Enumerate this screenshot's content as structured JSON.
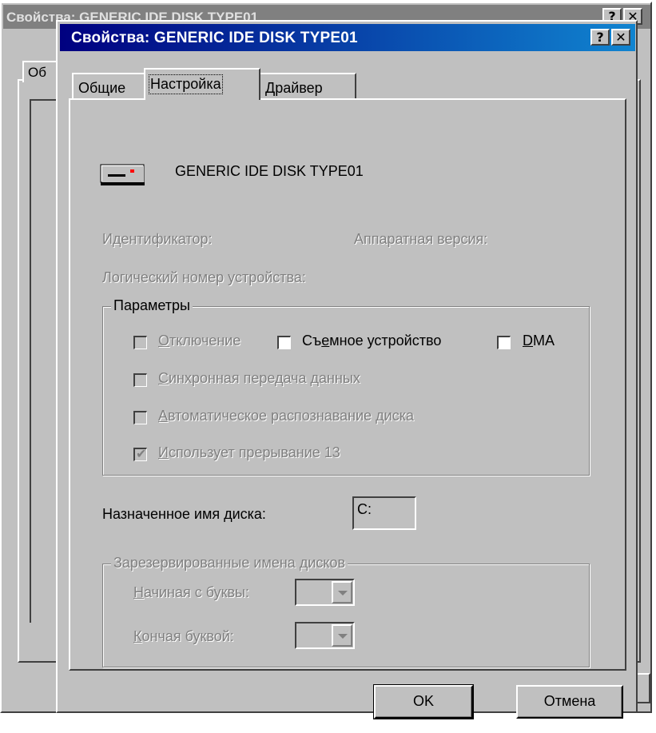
{
  "background_window": {
    "title": "Свойства: GENERIC IDE  DISK TYPE01",
    "tab_label": "Об"
  },
  "dialog": {
    "title": "Свойства: GENERIC IDE  DISK TYPE01",
    "help_button": "?",
    "close_button": "✕"
  },
  "tabs": [
    {
      "label": "Общие",
      "active": false
    },
    {
      "label": "Настройка",
      "active": true
    },
    {
      "label": "Драйвер",
      "active": false
    }
  ],
  "device": {
    "icon": "disk-drive-icon",
    "name": "GENERIC IDE  DISK TYPE01"
  },
  "info": {
    "identifier_label": "Идентификатор:",
    "hardware_version_label": "Аппаратная версия:",
    "logical_unit_label": "Логический номер устройства:"
  },
  "parameters": {
    "group_title": "Параметры",
    "disconnect": {
      "label": "Отключение",
      "underline": "О",
      "rest": "тключение",
      "checked": false,
      "enabled": false
    },
    "removable": {
      "label": "Съемное устройство",
      "before": "Съ",
      "underline": "е",
      "rest": "мное устройство",
      "checked": false,
      "enabled": true
    },
    "dma": {
      "label": "DMA",
      "underline": "D",
      "rest": "MA",
      "checked": false,
      "enabled": true
    },
    "sync_transfer": {
      "label": "Синхронная передача данных",
      "underline": "С",
      "rest": "инхронная передача данных",
      "checked": false,
      "enabled": false
    },
    "auto_detect": {
      "label": "Автоматическое распознавание диска",
      "underline": "А",
      "rest": "втоматическое распознавание диска",
      "checked": false,
      "enabled": false
    },
    "int13": {
      "label": "Использует прерывание 13",
      "underline": "И",
      "rest": "спользует прерывание 13",
      "checked": true,
      "enabled": false
    }
  },
  "drive_letter": {
    "label": "Назначенное имя диска:",
    "value": "C:"
  },
  "reserved": {
    "group_title": "Зарезервированные имена дисков",
    "start_label": "Начиная с буквы:",
    "start_underline": "Н",
    "start_rest": "ачиная с буквы:",
    "start_value": "",
    "end_label": "Кончая буквой:",
    "end_underline": "К",
    "end_rest": "ончая буквой:",
    "end_value": ""
  },
  "buttons": {
    "ok": "OK",
    "cancel": "Отмена"
  },
  "colors": {
    "face": "#c0c0c0",
    "title_active_start": "#000080",
    "title_active_end": "#1084d0",
    "title_inactive": "#808080",
    "disabled_text": "#808080"
  }
}
